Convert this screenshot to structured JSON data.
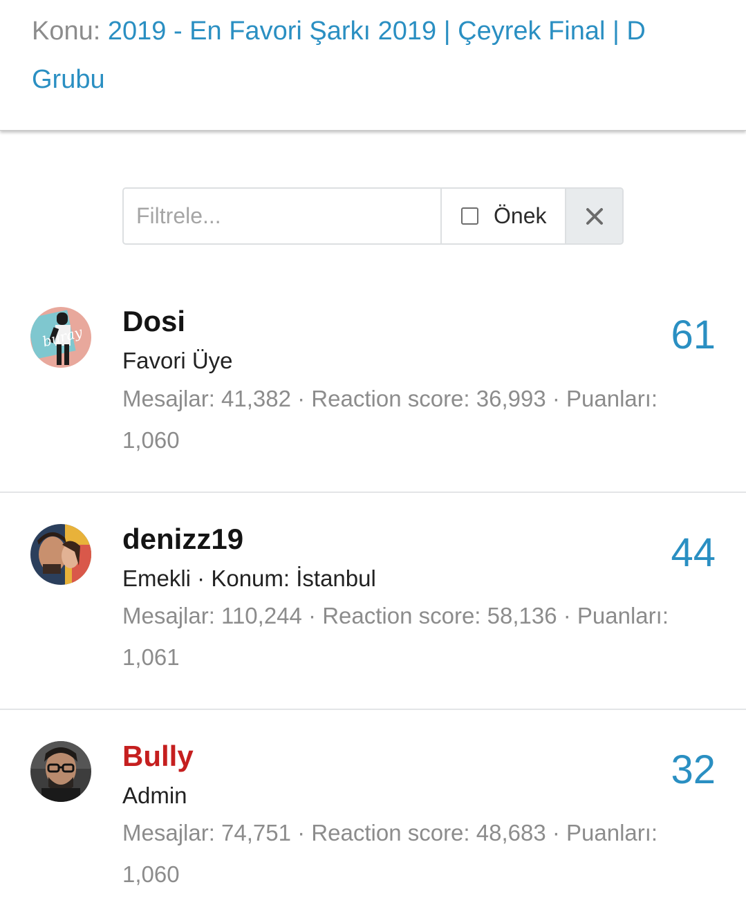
{
  "header": {
    "prefix": "Konu:",
    "thread_title": "2019 - En Favori Şarkı 2019 | Çeyrek Final | D Grubu"
  },
  "filter": {
    "placeholder": "Filtrele...",
    "prefix_label": "Önek",
    "prefix_checked": false,
    "clear_icon": "close-icon"
  },
  "members": [
    {
      "username": "Dosi",
      "title": "Favori Üye",
      "stats": "Mesajlar: 41,382 · Reaction score: 36,993 · Puanları: 1,060",
      "count": "61",
      "avatar": "user-avatar-image",
      "username_color": "#141414"
    },
    {
      "username": "denizz19",
      "title": "Emekli · Konum: İstanbul",
      "stats": "Mesajlar: 110,244 · Reaction score: 58,136 · Puanları: 1,061",
      "count": "44",
      "avatar": "user-avatar-image",
      "username_color": "#141414"
    },
    {
      "username": "Bully",
      "title": "Admin",
      "stats": "Mesajlar: 74,751 · Reaction score: 48,683 · Puanları: 1,060",
      "count": "32",
      "avatar": "user-avatar-image",
      "username_color": "#c51f1f"
    }
  ],
  "colors": {
    "link": "#2a8fc2",
    "muted": "#8c8c8c",
    "admin": "#c51f1f"
  }
}
